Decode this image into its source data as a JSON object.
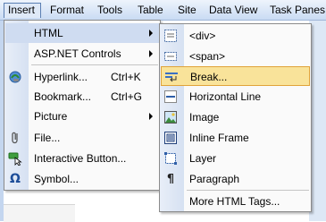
{
  "menubar": {
    "items": [
      {
        "label": "Insert"
      },
      {
        "label": "Format"
      },
      {
        "label": "Tools"
      },
      {
        "label": "Table"
      },
      {
        "label": "Site"
      },
      {
        "label": "Data View"
      },
      {
        "label": "Task Panes"
      }
    ]
  },
  "insert_menu": {
    "items": [
      {
        "label": "HTML",
        "icon": "none",
        "submenu": true
      },
      {
        "label": "ASP.NET Controls",
        "icon": "none",
        "submenu": true
      },
      {
        "label": "Hyperlink...",
        "shortcut": "Ctrl+K",
        "icon": "hyperlink-icon"
      },
      {
        "label": "Bookmark...",
        "shortcut": "Ctrl+G",
        "icon": "none"
      },
      {
        "label": "Picture",
        "icon": "none",
        "submenu": true
      },
      {
        "label": "File...",
        "icon": "paperclip-icon"
      },
      {
        "label": "Interactive Button...",
        "icon": "interactive-button-icon"
      },
      {
        "label": "Symbol...",
        "icon": "omega-icon"
      }
    ]
  },
  "html_submenu": {
    "items": [
      {
        "label": "<div>",
        "icon": "div-icon"
      },
      {
        "label": "<span>",
        "icon": "span-icon"
      },
      {
        "label": "Break...",
        "icon": "break-icon"
      },
      {
        "label": "Horizontal Line",
        "icon": "horizontal-line-icon"
      },
      {
        "label": "Image",
        "icon": "image-icon"
      },
      {
        "label": "Inline Frame",
        "icon": "inline-frame-icon"
      },
      {
        "label": "Layer",
        "icon": "layer-icon"
      },
      {
        "label": "Paragraph",
        "icon": "paragraph-icon"
      },
      {
        "label": "More HTML Tags..."
      }
    ]
  },
  "colors": {
    "highlight_fill": "#f9e39a",
    "highlight_border": "#e0a33a",
    "menubar_gradient_top": "#eef4fc",
    "menubar_gradient_bottom": "#c9dbf3"
  }
}
